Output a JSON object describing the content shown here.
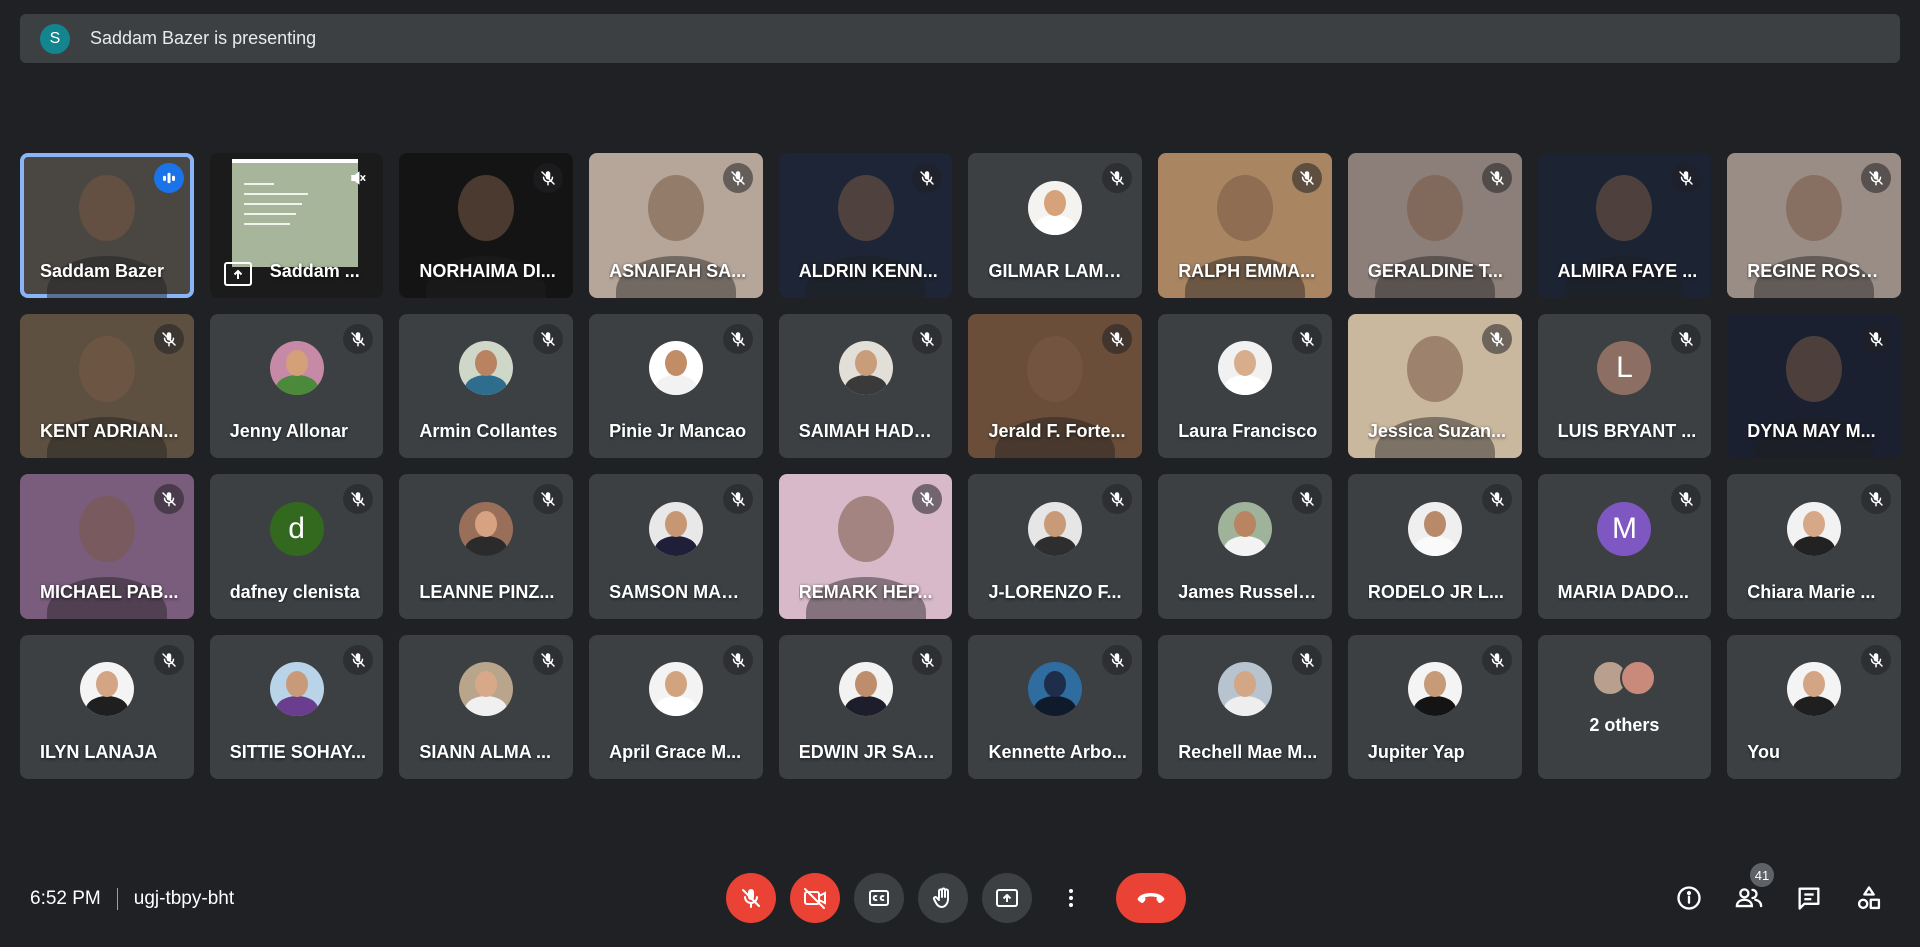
{
  "banner": {
    "avatar_letter": "S",
    "text": "Saddam Bazer is presenting"
  },
  "tiles": [
    {
      "name": "Saddam Bazer",
      "kind": "video",
      "speaking": true,
      "bg": "#4a4642"
    },
    {
      "name": "Saddam ...",
      "kind": "presentation",
      "bg": "#1b1b1b"
    },
    {
      "name": "NORHAIMA DI...",
      "kind": "video",
      "bg": "#141414"
    },
    {
      "name": "ASNAIFAH SA...",
      "kind": "video",
      "bg": "#b6a69a"
    },
    {
      "name": "ALDRIN KENN...",
      "kind": "video",
      "bg": "#1d2536"
    },
    {
      "name": "GILMAR LAME...",
      "kind": "avatar",
      "bg": "#3c4043",
      "avatar_bg": "#f5f3ef",
      "skin": "#d6a27a",
      "cloth": "#ffffff"
    },
    {
      "name": "RALPH EMMA...",
      "kind": "video",
      "bg": "#a98562"
    },
    {
      "name": "GERALDINE T...",
      "kind": "video",
      "bg": "#8c7e78"
    },
    {
      "name": "ALMIRA FAYE ...",
      "kind": "video",
      "bg": "#1c2333"
    },
    {
      "name": "REGINE ROSE ...",
      "kind": "video",
      "bg": "#9a8d86"
    },
    {
      "name": "KENT ADRIAN...",
      "kind": "video",
      "bg": "#5e5040"
    },
    {
      "name": "Jenny Allonar",
      "kind": "avatar",
      "bg": "#3c4043",
      "avatar_bg": "#c68aa6",
      "skin": "#d4a07a",
      "cloth": "#4a8a3a"
    },
    {
      "name": "Armin Collantes",
      "kind": "avatar",
      "bg": "#3c4043",
      "avatar_bg": "#cfd8c8",
      "skin": "#b98260",
      "cloth": "#2f6d8f"
    },
    {
      "name": "Pinie Jr Mancao",
      "kind": "avatar",
      "bg": "#3c4043",
      "avatar_bg": "#ffffff",
      "skin": "#c18d66",
      "cloth": "#f2f2f2"
    },
    {
      "name": "SAIMAH HADJ...",
      "kind": "avatar",
      "bg": "#3c4043",
      "avatar_bg": "#e2dfd8",
      "skin": "#c99c7a",
      "cloth": "#3a3a3a"
    },
    {
      "name": "Jerald F. Forte...",
      "kind": "video",
      "bg": "#6a4e3a"
    },
    {
      "name": "Laura Francisco",
      "kind": "avatar",
      "bg": "#3c4043",
      "avatar_bg": "#f1f1f1",
      "skin": "#d8ad8c",
      "cloth": "#ffffff"
    },
    {
      "name": "Jessica Suzan...",
      "kind": "video",
      "bg": "#c9b79e"
    },
    {
      "name": "LUIS BRYANT ...",
      "kind": "letter",
      "bg": "#3c4043",
      "letter": "L",
      "avatar_bg": "#8d6e63"
    },
    {
      "name": "DYNA MAY M...",
      "kind": "video",
      "bg": "#1a2030"
    },
    {
      "name": "MICHAEL PAB...",
      "kind": "video",
      "bg": "#7a5c7c"
    },
    {
      "name": "dafney clenista",
      "kind": "letter",
      "bg": "#3c4043",
      "letter": "d",
      "avatar_bg": "#33691e"
    },
    {
      "name": "LEANNE PINZ...",
      "kind": "avatar",
      "bg": "#3c4043",
      "avatar_bg": "#9a6f5a",
      "skin": "#d6a282",
      "cloth": "#2b2b2b"
    },
    {
      "name": "SAMSON MAN...",
      "kind": "avatar",
      "bg": "#3c4043",
      "avatar_bg": "#e8e8e8",
      "skin": "#c79673",
      "cloth": "#1f1f3a"
    },
    {
      "name": "REMARK HEP...",
      "kind": "video",
      "bg": "#d7b9c9"
    },
    {
      "name": "J-LORENZO F...",
      "kind": "avatar",
      "bg": "#3c4043",
      "avatar_bg": "#e6e6e6",
      "skin": "#c99a78",
      "cloth": "#2e2e2e"
    },
    {
      "name": "James Russel ...",
      "kind": "avatar",
      "bg": "#3c4043",
      "avatar_bg": "#9fb39a",
      "skin": "#b88462",
      "cloth": "#f3f3f3"
    },
    {
      "name": "RODELO JR L...",
      "kind": "avatar",
      "bg": "#3c4043",
      "avatar_bg": "#efefef",
      "skin": "#b98a6a",
      "cloth": "#fafafa"
    },
    {
      "name": "MARIA DADO...",
      "kind": "letter",
      "bg": "#3c4043",
      "letter": "M",
      "avatar_bg": "#7e57c2"
    },
    {
      "name": "Chiara Marie ...",
      "kind": "avatar",
      "bg": "#3c4043",
      "avatar_bg": "#f2f2f2",
      "skin": "#d7a887",
      "cloth": "#222222"
    },
    {
      "name": "ILYN LANAJA",
      "kind": "avatar",
      "bg": "#3c4043",
      "avatar_bg": "#f4f4f4",
      "skin": "#d4a584",
      "cloth": "#1f1f1f"
    },
    {
      "name": "SITTIE SOHAY...",
      "kind": "avatar",
      "bg": "#3c4043",
      "avatar_bg": "#b9d4e8",
      "skin": "#c99a7a",
      "cloth": "#6b3d8f"
    },
    {
      "name": "SIANN ALMA ...",
      "kind": "avatar",
      "bg": "#3c4043",
      "avatar_bg": "#b9a58c",
      "skin": "#d8a988",
      "cloth": "#f0f0f0"
    },
    {
      "name": "April Grace M...",
      "kind": "avatar",
      "bg": "#3c4043",
      "avatar_bg": "#f3f3f3",
      "skin": "#d2a37f",
      "cloth": "#ffffff"
    },
    {
      "name": "EDWIN JR SAL...",
      "kind": "avatar",
      "bg": "#3c4043",
      "avatar_bg": "#f2f2f2",
      "skin": "#be8d6b",
      "cloth": "#1d1d2b"
    },
    {
      "name": "Kennette Arbo...",
      "kind": "avatar",
      "bg": "#3c4043",
      "avatar_bg": "#2f6c9f",
      "skin": "#1d2d4a",
      "cloth": "#0f1a2a"
    },
    {
      "name": "Rechell Mae M...",
      "kind": "avatar",
      "bg": "#3c4043",
      "avatar_bg": "#b7c4d0",
      "skin": "#d3a685",
      "cloth": "#eeeeee"
    },
    {
      "name": "Jupiter Yap",
      "kind": "avatar",
      "bg": "#3c4043",
      "avatar_bg": "#f4f4f4",
      "skin": "#c79a78",
      "cloth": "#141414"
    },
    {
      "name": "2 others",
      "kind": "others",
      "bg": "#3c4043"
    },
    {
      "name": "You",
      "kind": "avatar",
      "bg": "#3c4043",
      "avatar_bg": "#f4f4f4",
      "skin": "#d4a584",
      "cloth": "#1f1f1f"
    }
  ],
  "meeting": {
    "time": "6:52 PM",
    "code": "ugj-tbpy-bht"
  },
  "controls": [
    "mic-off",
    "camera-off",
    "captions",
    "raise-hand",
    "present-now",
    "more-options",
    "leave-call"
  ],
  "right_panel": {
    "people_count": "41",
    "icons": [
      "info-icon",
      "people-icon",
      "chat-icon",
      "activities-icon"
    ]
  },
  "colors": {
    "background": "#202124",
    "tile": "#3c4043",
    "danger": "#ea4335",
    "speaking_border": "#8ab4f8"
  }
}
